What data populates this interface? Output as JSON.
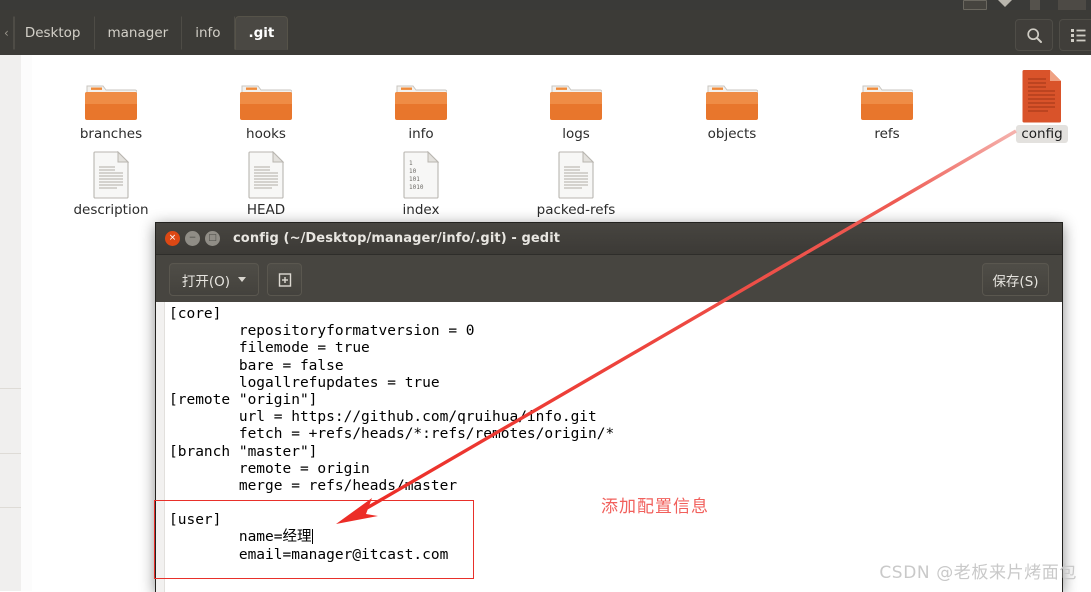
{
  "window": {
    "file_manager": {
      "breadcrumbs": [
        {
          "label": "Desktop",
          "active": false
        },
        {
          "label": "manager",
          "active": false
        },
        {
          "label": "info",
          "active": false
        },
        {
          "label": ".git",
          "active": true
        }
      ],
      "search_icon": "search-icon",
      "view_mode_icon": "list-view-icon"
    },
    "files": [
      {
        "name": "branches",
        "type": "folder",
        "selected": false
      },
      {
        "name": "hooks",
        "type": "folder",
        "selected": false
      },
      {
        "name": "info",
        "type": "folder",
        "selected": false
      },
      {
        "name": "logs",
        "type": "folder",
        "selected": false
      },
      {
        "name": "objects",
        "type": "folder",
        "selected": false
      },
      {
        "name": "refs",
        "type": "folder",
        "selected": false
      },
      {
        "name": "config",
        "type": "file-selected",
        "selected": true
      },
      {
        "name": "description",
        "type": "file",
        "selected": false
      },
      {
        "name": "HEAD",
        "type": "file",
        "selected": false
      },
      {
        "name": "index",
        "type": "file-binary",
        "selected": false
      },
      {
        "name": "packed-refs",
        "type": "file",
        "selected": false
      }
    ],
    "index_icon_lines": [
      "1",
      "10",
      "101",
      "1010"
    ]
  },
  "gedit": {
    "title": "config (~/Desktop/manager/info/.git) - gedit",
    "controls": {
      "close": "×",
      "minimize": "−",
      "maximize": "□"
    },
    "toolbar": {
      "open_label": "打开(O)",
      "new_tab_icon": "new-document-icon",
      "save_label": "保存(S)"
    },
    "document_lines": [
      "[core]",
      "        repositoryformatversion = 0",
      "        filemode = true",
      "        bare = false",
      "        logallrefupdates = true",
      "[remote \"origin\"]",
      "        url = https://github.com/qruihua/info.git",
      "        fetch = +refs/heads/*:refs/remotes/origin/*",
      "[branch \"master\"]",
      "        remote = origin",
      "        merge = refs/heads/master",
      "",
      "[user]",
      "        name=经理",
      "        email=manager@itcast.com"
    ],
    "cursor_line_index": 13
  },
  "annotations": {
    "callout_text": "添加配置信息",
    "callout_color": "#f1605c",
    "highlight_box_color": "#e8302a",
    "arrow_color": "#ec2d27"
  },
  "watermark": {
    "text": "CSDN @老板来片烤面包",
    "color": "#c9c9c9"
  },
  "colors": {
    "header_bg": "#3c3b37",
    "folder_orange": "#e8762c",
    "selected_file_orange": "#d9532a",
    "gedit_titlebar": "#413f3b",
    "gedit_toolbar": "#474540",
    "close_button": "#dd4814"
  }
}
